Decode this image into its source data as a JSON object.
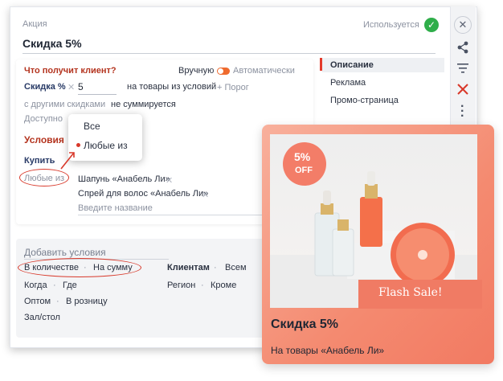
{
  "header": {
    "section_label": "Акция",
    "status_text": "Используется",
    "title": "Скидка 5%"
  },
  "reward": {
    "heading": "Что получит клиент?",
    "mode_manual": "Вручную",
    "mode_auto": "Автоматически",
    "discount_label": "Скидка %",
    "discount_value": "5",
    "applies_to": "на товары из условий",
    "threshold": "+ Порог",
    "combine_label": "с другими скидками",
    "combine_value": "не суммируется",
    "available_label": "Доступно"
  },
  "conditions": {
    "heading": "Условия",
    "action": "Купить",
    "selector": "Любые из",
    "products": [
      "Шапунь «Анабель Ли»",
      "Спрей для волос «Анабель Ли»"
    ],
    "product_placeholder": "Введите название"
  },
  "dropdown": {
    "options": [
      "Все",
      "Любые из"
    ],
    "selected": "Любые из"
  },
  "add_conditions": {
    "heading": "Добавить условия",
    "row1": [
      "В количестве",
      "На сумму"
    ],
    "row2": [
      "Когда",
      "Где"
    ],
    "row3": [
      "Оптом",
      "В розницу"
    ],
    "row4": [
      "Зал/стол"
    ],
    "clients_label": "Клиентам",
    "clients_value": "Всем",
    "region_label": "Регион",
    "region_value": "Кроме"
  },
  "tabs": [
    "Описание",
    "Реклама",
    "Промо-страница"
  ],
  "side_icons": [
    "close-icon",
    "share-icon",
    "filter-list-icon",
    "delete-icon",
    "more-vertical-icon"
  ],
  "promo": {
    "badge_pct": "5%",
    "badge_off": "OFF",
    "flash": "Flash Sale!",
    "title": "Скидка 5%",
    "subtitle": "На товары «Анабель Ли»"
  },
  "colors": {
    "accent_red": "#b4341f",
    "toggle_orange": "#ef6b2f",
    "status_green": "#2fae4a",
    "promo_coral": "#f48a70"
  }
}
